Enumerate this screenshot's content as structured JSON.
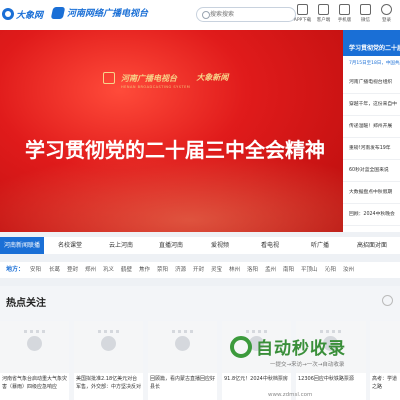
{
  "header": {
    "logo_text": "大象网",
    "logo2_text": "河南网络广播电视台",
    "search_placeholder": "搜索搜索",
    "icons": [
      {
        "name": "app-icon",
        "label": "APP下载"
      },
      {
        "name": "phone-icon",
        "label": "客户端"
      },
      {
        "name": "mobile-icon",
        "label": "手机版"
      },
      {
        "name": "wechat-icon",
        "label": "微信"
      },
      {
        "name": "user-icon",
        "label": "登录"
      }
    ]
  },
  "banner": {
    "logo1": "河南广播电视台",
    "logo1_sub": "HENAN BROADCASTING SYSTEM",
    "logo2": "大象新闻",
    "title": "学习贯彻党的二十届三中全会精神"
  },
  "news_panel": {
    "headline": "学习贯彻党的二十届",
    "date": "7月15日至18日，中国共产",
    "items": [
      "河南广播电视台组织",
      "穿越千年，这份来自中",
      "传递温暖！郑州开展",
      "重磅!河南发布19年",
      "60秒对蓝全国来说",
      "大数据盘点中秋假期",
      "回顾：2024中秋晚会"
    ]
  },
  "tabs": [
    {
      "label": "河南新闻联播",
      "active": true
    },
    {
      "label": "名校课堂",
      "active": false
    },
    {
      "label": "云上河南",
      "active": false
    },
    {
      "label": "直播河南",
      "active": false
    },
    {
      "label": "爱视频",
      "active": false
    },
    {
      "label": "看电视",
      "active": false
    },
    {
      "label": "听广播",
      "active": false
    },
    {
      "label": "高招面对面",
      "active": false
    }
  ],
  "regions": {
    "label": "地方：",
    "items": [
      "安阳",
      "长葛",
      "登封",
      "郑州",
      "巩义",
      "鹤壁",
      "焦作",
      "荥阳",
      "济源",
      "开封",
      "灵宝",
      "林州",
      "洛阳",
      "孟州",
      "南阳",
      "平顶山",
      "沁阳",
      "汝州"
    ]
  },
  "hot": {
    "title": "热点关注",
    "cards": [
      {
        "caption": "河南省气象台启动重大气象灾害（暴雨）四级应急响应"
      },
      {
        "caption": "美国拟批准2.18亿美元对台军售，外交部：中方坚决反对"
      },
      {
        "caption": "回顾篇，看内蒙古直播回应好县长"
      },
      {
        "caption": "91.8亿元！2024中秋档票房"
      },
      {
        "caption": "12306回应中秋铁路票源"
      },
      {
        "caption": "高考：学道之路"
      }
    ]
  },
  "watermark": {
    "text": "自动秒收录",
    "sub": "一提交→来访→一次→自动收录",
    "url": "www.zdmsl.com"
  }
}
